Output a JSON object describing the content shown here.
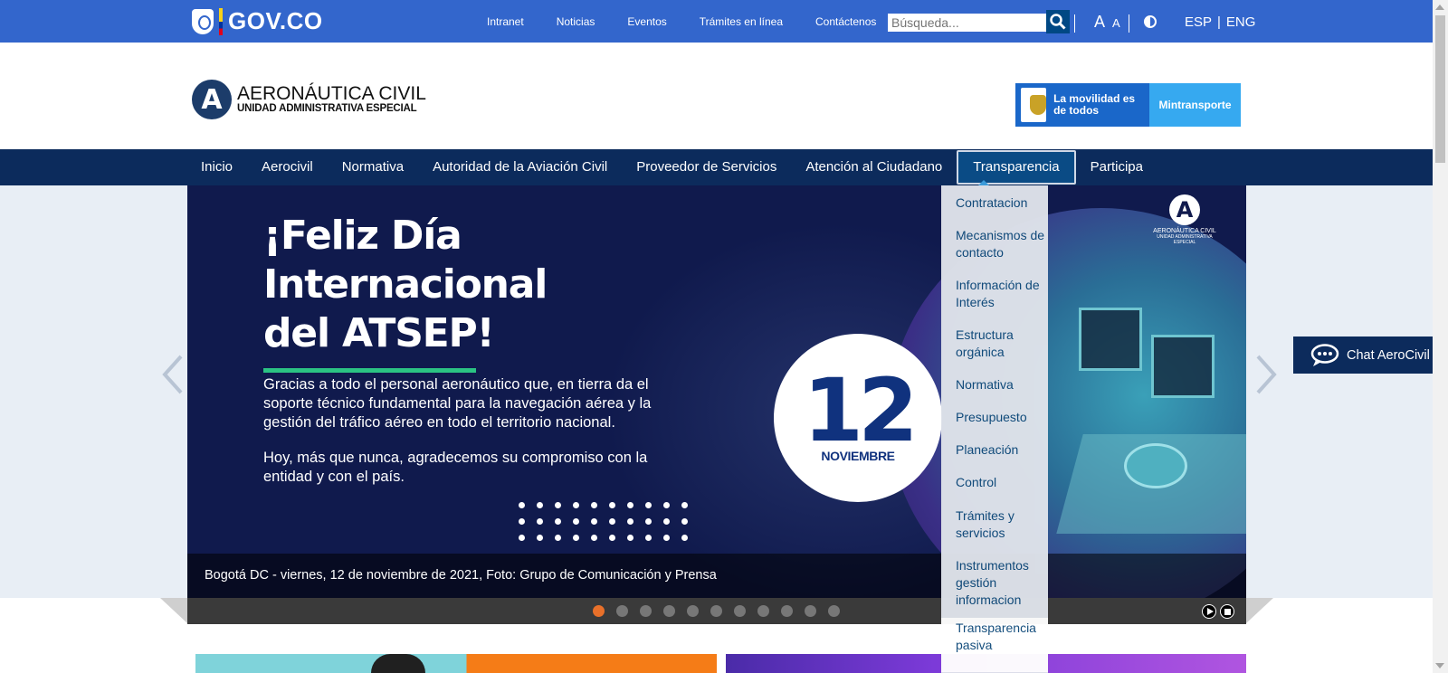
{
  "govbar": {
    "logo_text": "GOV.CO",
    "links": [
      "Intranet",
      "Noticias",
      "Eventos",
      "Trámites en línea",
      "Contáctenos"
    ],
    "search_placeholder": "Búsqueda...",
    "font_large": "A",
    "font_small": "A",
    "lang_es": "ESP",
    "lang_sep": "|",
    "lang_en": "ENG"
  },
  "header": {
    "logo_letter": "A",
    "org_name": "AERONÁUTICA CIVIL",
    "org_subtitle": "UNIDAD ADMINISTRATIVA ESPECIAL",
    "partner_slogan": "La movilidad es de todos",
    "partner_name": "Mintransporte"
  },
  "nav": {
    "items": [
      "Inicio",
      "Aerocivil",
      "Normativa",
      "Autoridad de la Aviación Civil",
      "Proveedor de Servicios",
      "Atención al Ciudadano",
      "Transparencia",
      "Participa"
    ],
    "active": "Transparencia"
  },
  "dropdown": {
    "items": [
      "Contratacion",
      "Mecanismos de contacto",
      "Información de Interés",
      "Estructura orgánica",
      "Normativa",
      "Presupuesto",
      "Planeación",
      "Control",
      "Trámites y servicios",
      "Instrumentos gestión informacion",
      "Transparencia pasiva"
    ]
  },
  "slide": {
    "title_1": "¡Feliz Día",
    "title_2": "Internacional",
    "title_3": "del ATSEP!",
    "paragraph_1": "Gracias a todo el personal aeronáutico que, en tierra da el soporte técnico fundamental para la navegación aérea y la gestión del tráfico aéreo en todo el territorio nacional.",
    "paragraph_2": "Hoy, más que nunca, agradecemos su compromiso con la entidad y con el país.",
    "date_day": "12",
    "date_month": "NOVIEMBRE",
    "mini_logo_letter": "A",
    "mini_logo_name": "AERONÁUTICA CIVIL",
    "mini_logo_sub": "UNIDAD ADMINISTRATIVA ESPECIAL",
    "caption": "Bogotá DC - viernes, 12 de noviembre de 2021, Foto: Grupo de Comunicación y Prensa",
    "total_slides": 11,
    "current_slide": 1
  },
  "chat": {
    "label": "Chat AeroCivil"
  },
  "colors": {
    "gov_blue": "#3366cc",
    "nav_navy": "#0c2b5c",
    "active_dot": "#e8702a",
    "accent_green": "#2bc383"
  }
}
